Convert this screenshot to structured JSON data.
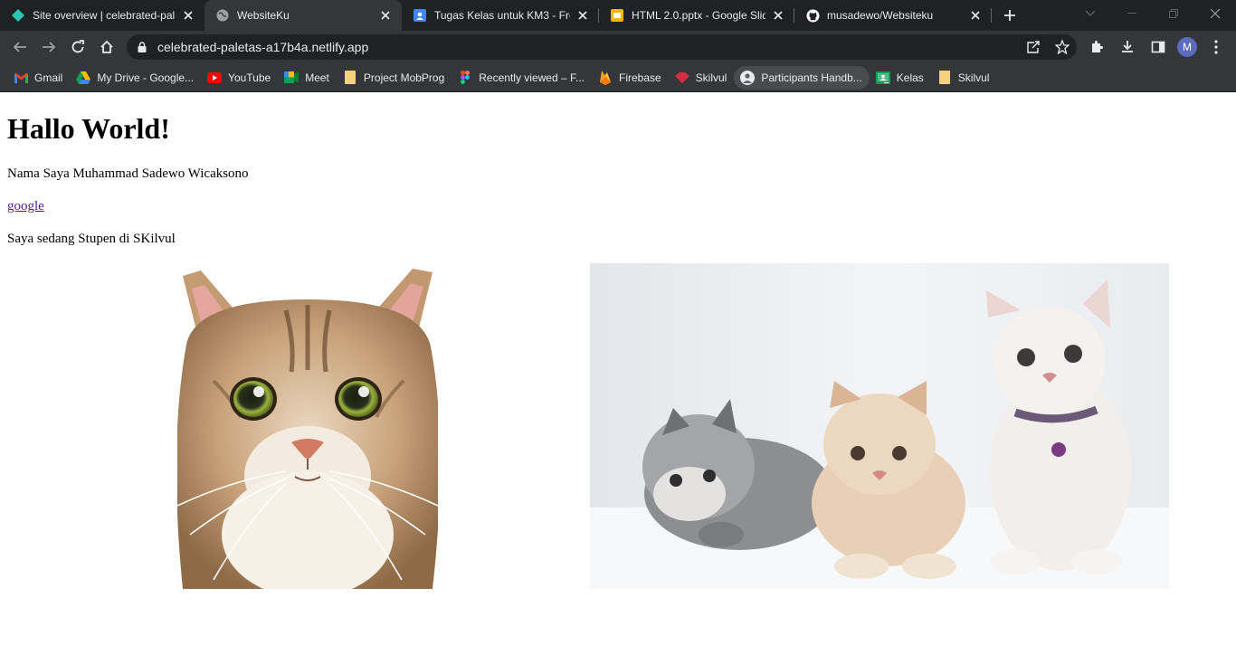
{
  "tabs": [
    {
      "title": "Site overview | celebrated-pal",
      "icon": "netlify-icon",
      "active": false
    },
    {
      "title": "WebsiteKu",
      "icon": "globe-icon",
      "active": true
    },
    {
      "title": "Tugas Kelas untuk KM3 - From",
      "icon": "classroom-icon",
      "active": false
    },
    {
      "title": "HTML 2.0.pptx - Google Slides",
      "icon": "slides-icon",
      "active": false
    },
    {
      "title": "musadewo/Websiteku",
      "icon": "github-icon",
      "active": false
    }
  ],
  "toolbar": {
    "url": "celebrated-paletas-a17b4a.netlify.app",
    "profile_initial": "M"
  },
  "bookmarks": [
    {
      "label": "Gmail",
      "icon": "gmail-icon"
    },
    {
      "label": "My Drive - Google...",
      "icon": "drive-icon"
    },
    {
      "label": "YouTube",
      "icon": "youtube-icon"
    },
    {
      "label": "Meet",
      "icon": "meet-icon"
    },
    {
      "label": "Project MobProg",
      "icon": "folder-icon"
    },
    {
      "label": "Recently viewed – F...",
      "icon": "figma-icon"
    },
    {
      "label": "Firebase",
      "icon": "firebase-icon"
    },
    {
      "label": "Skilvul",
      "icon": "skilvul-icon"
    },
    {
      "label": "Participants Handb...",
      "icon": "handbook-icon"
    },
    {
      "label": "Kelas",
      "icon": "classroom-icon"
    },
    {
      "label": "Skilvul",
      "icon": "folder-icon"
    }
  ],
  "page": {
    "heading": "Hallo World!",
    "intro": "Nama Saya Muhammad Sadewo Wicaksono",
    "link": "google",
    "status": "Saya sedang Stupen di SKilvul"
  },
  "colors": {
    "tab_strip": "#202124",
    "toolbar": "#35363a",
    "link": "#551a8b"
  }
}
